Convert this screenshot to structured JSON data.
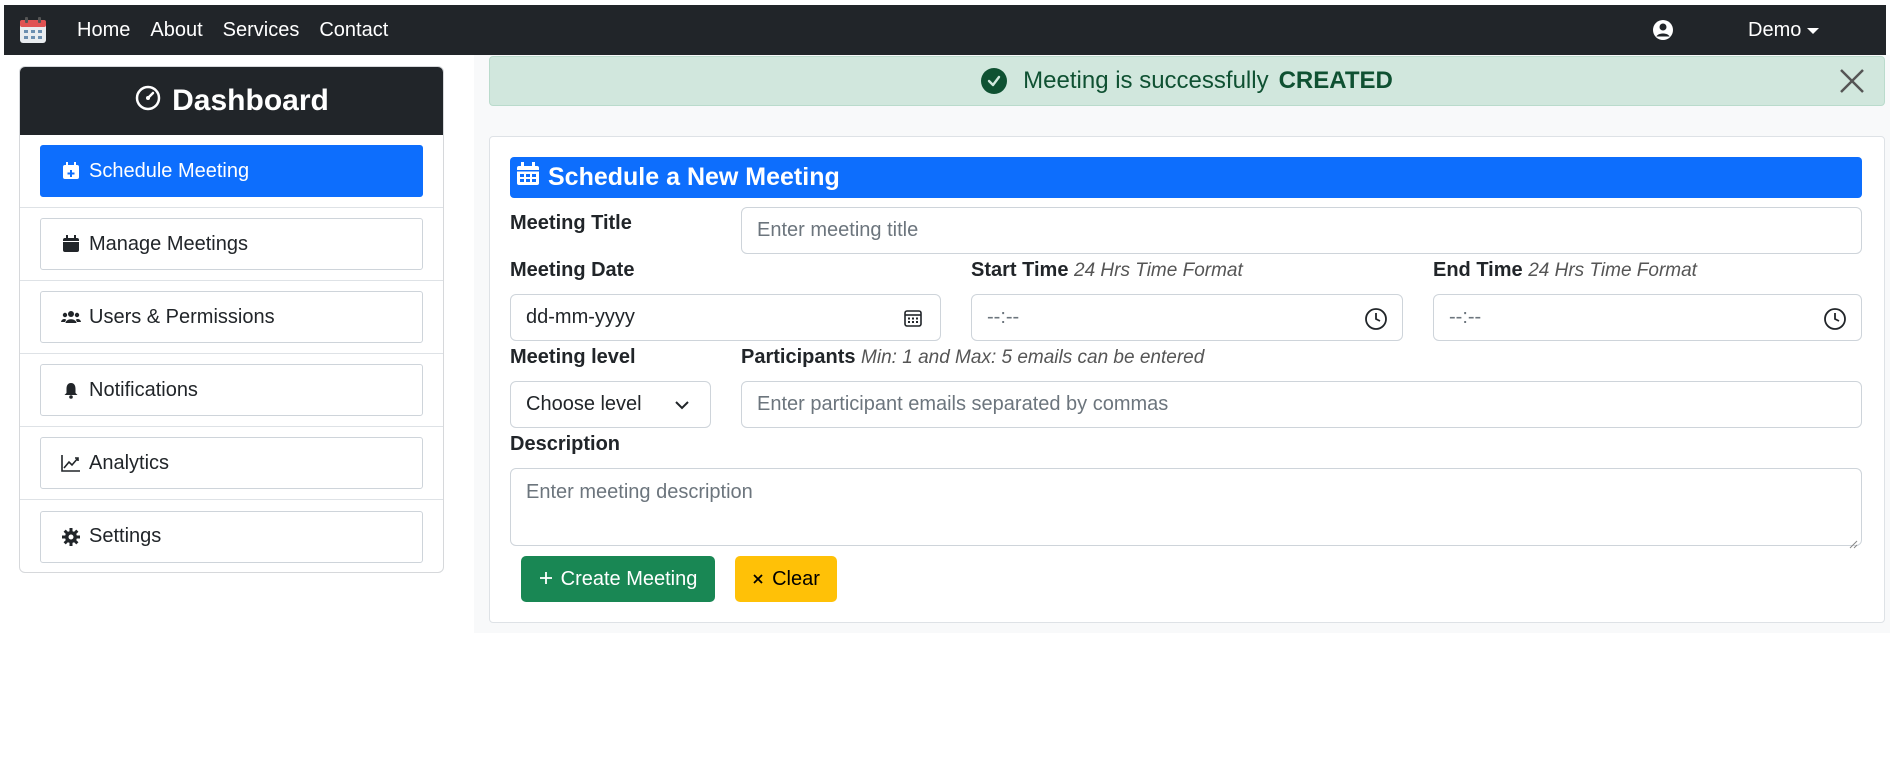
{
  "nav": {
    "links": [
      "Home",
      "About",
      "Services",
      "Contact"
    ],
    "user_label": "Demo"
  },
  "sidebar": {
    "title": "Dashboard",
    "items": [
      {
        "label": "Schedule Meeting",
        "icon": "calendar-plus-icon",
        "active": true
      },
      {
        "label": "Manage Meetings",
        "icon": "calendar-icon",
        "active": false
      },
      {
        "label": "Users & Permissions",
        "icon": "users-icon",
        "active": false
      },
      {
        "label": "Notifications",
        "icon": "bell-icon",
        "active": false
      },
      {
        "label": "Analytics",
        "icon": "chart-line-icon",
        "active": false
      },
      {
        "label": "Settings",
        "icon": "gear-icon",
        "active": false
      }
    ]
  },
  "alert": {
    "text": "Meeting is successfully",
    "emphasis": "CREATED"
  },
  "form": {
    "title": "Schedule a New Meeting",
    "meeting_title_label": "Meeting Title",
    "meeting_title_placeholder": "Enter meeting title",
    "meeting_date_label": "Meeting Date",
    "meeting_date_value": "dd-mm-yyyy",
    "start_time_label": "Start Time",
    "start_time_hint": "24 Hrs Time Format",
    "start_time_value": "--:--",
    "end_time_label": "End Time",
    "end_time_hint": "24 Hrs Time Format",
    "end_time_value": "--:--",
    "level_label": "Meeting level",
    "level_value": "Choose level",
    "participants_label": "Participants",
    "participants_hint": "Min: 1 and Max: 5 emails can be entered",
    "participants_placeholder": "Enter participant emails separated by commas",
    "description_label": "Description",
    "description_placeholder": "Enter meeting description",
    "create_button": "Create Meeting",
    "clear_button": "Clear"
  },
  "colors": {
    "primary": "#0d6efd",
    "dark": "#212529",
    "success": "#198754",
    "warning": "#ffc107",
    "alert_bg": "#d1e7dd"
  }
}
